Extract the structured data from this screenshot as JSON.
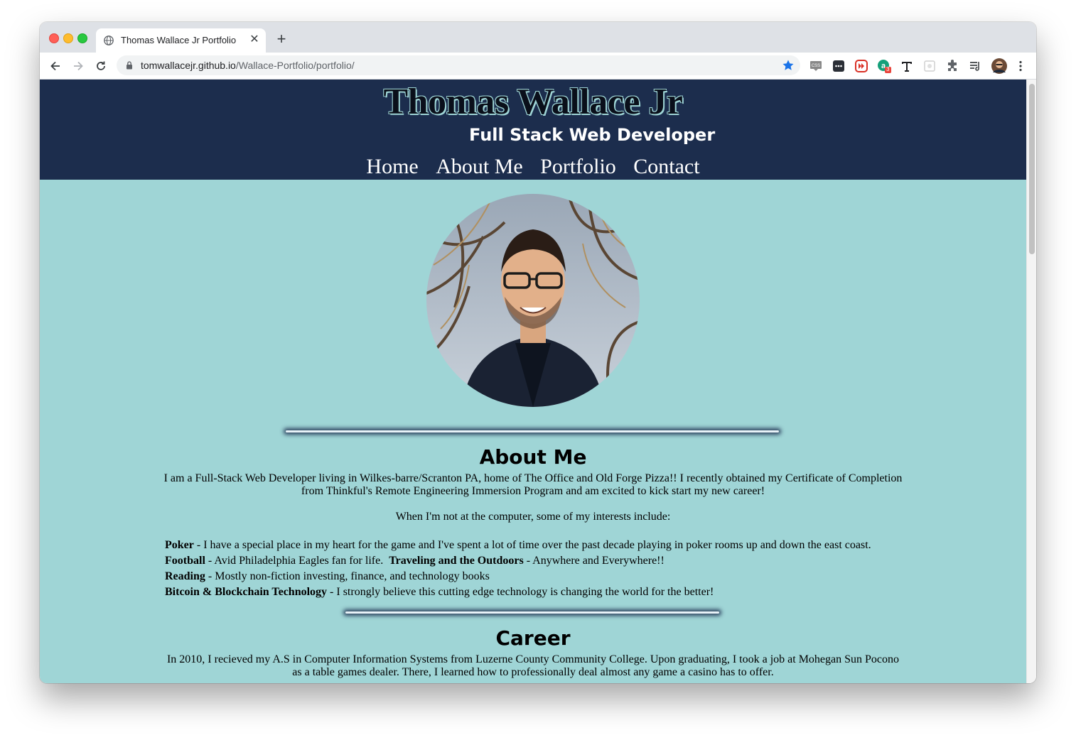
{
  "browser": {
    "tab_title": "Thomas Wallace Jr Portfolio",
    "url_host": "tomwallacejr.github.io",
    "url_path": "/Wallace-Portfolio/portfolio/",
    "extension_badge": "3"
  },
  "header": {
    "title": "Thomas Wallace Jr",
    "subtitle": "Full Stack Web Developer",
    "nav": [
      "Home",
      "About Me",
      "Portfolio",
      "Contact"
    ]
  },
  "about": {
    "heading": "About Me",
    "intro_line1": "I am a Full-Stack Web Developer living in Wilkes-barre/Scranton PA, home of The Office and Old Forge Pizza!! I recently obtained my Certificate of Completion",
    "intro_line2": "from Thinkful's Remote Engineering Immersion Program and am excited to kick start my new career!",
    "interests_intro": "When I'm not at the computer, some of my interests include:",
    "interests": [
      {
        "name": "Poker",
        "desc": " - I have a special place in my heart for the game and I've spent a lot of time over the past decade playing in poker rooms up and down the east coast."
      },
      {
        "name": "Football",
        "desc": " - Avid Philadelphia Eagles fan for life.  "
      },
      {
        "name": "Traveling and the Outdoors",
        "desc": " - Anywhere and Everywhere!!"
      },
      {
        "name": "Reading",
        "desc": " - Mostly non-fiction investing, finance, and technology books"
      },
      {
        "name": "Bitcoin & Blockchain Technology",
        "desc": " - I strongly believe this cutting edge technology is changing the world for the better!"
      }
    ]
  },
  "career": {
    "heading": "Career",
    "line1": "In 2010, I recieved my A.S in Computer Information Systems from Luzerne County Community College. Upon graduating, I took a job at Mohegan Sun Pocono",
    "line2": "as a table games dealer. There, I learned how to professionally deal almost any game a casino has to offer."
  },
  "colors": {
    "header_bg": "#1c2d4d",
    "page_bg": "#9fd5d6",
    "accent_star": "#1a73e8"
  }
}
